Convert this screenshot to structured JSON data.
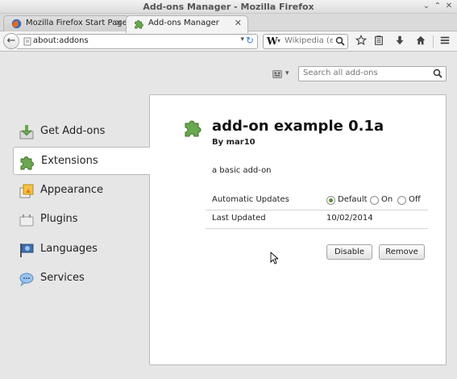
{
  "window": {
    "title": "Add-ons Manager - Mozilla Firefox",
    "minimize_glyph": "⌄",
    "maximize_glyph": "⌃",
    "close_glyph": "✕"
  },
  "tabs": [
    {
      "label": "Mozilla Firefox Start Page",
      "icon": "firefox-icon",
      "active": false
    },
    {
      "label": "Add-ons Manager",
      "icon": "puzzle-icon",
      "active": true
    }
  ],
  "tab_close_glyph": "✕",
  "new_tab_glyph": "+",
  "navbar": {
    "back_glyph": "←",
    "url": "about:addons",
    "url_dropdown_glyph": "▾",
    "reload_glyph": "↻",
    "search_engine": "W",
    "search_engine_dropdown_glyph": "▾",
    "search_placeholder": "Wikipedia (en)",
    "icons": [
      "bookmark-star-icon",
      "reading-list-icon",
      "download-icon",
      "home-icon",
      "menu-icon"
    ]
  },
  "addon_search": {
    "placeholder": "Search all add-ons",
    "tools_glyph": "▾"
  },
  "categories": [
    {
      "label": "Get Add-ons",
      "icon": "get-addons-icon",
      "selected": false
    },
    {
      "label": "Extensions",
      "icon": "puzzle-icon",
      "selected": true
    },
    {
      "label": "Appearance",
      "icon": "appearance-icon",
      "selected": false
    },
    {
      "label": "Plugins",
      "icon": "plugin-icon",
      "selected": false
    },
    {
      "label": "Languages",
      "icon": "languages-icon",
      "selected": false
    },
    {
      "label": "Services",
      "icon": "services-icon",
      "selected": false
    }
  ],
  "addon": {
    "name": "add-on example 0.1a",
    "creator": "By mar10",
    "description": "a basic add-on",
    "automatic_updates_label": "Automatic Updates",
    "update_options": [
      {
        "label": "Default",
        "selected": true
      },
      {
        "label": "On",
        "selected": false
      },
      {
        "label": "Off",
        "selected": false
      }
    ],
    "last_updated_label": "Last Updated",
    "last_updated_value": "10/02/2014",
    "disable_button": "Disable",
    "remove_button": "Remove"
  },
  "colors": {
    "accent_green": "#5b8d3a",
    "puzzle_green": "#6aa84f",
    "background": "#e6e6e6"
  }
}
